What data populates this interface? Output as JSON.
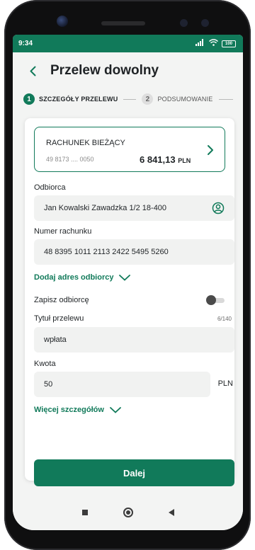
{
  "status_bar": {
    "time": "9:34",
    "signal": "5G",
    "battery": "100"
  },
  "header": {
    "title": "Przelew dowolny"
  },
  "steps": [
    {
      "number": "1",
      "label": "SZCZEGÓŁY PRZELEWU"
    },
    {
      "number": "2",
      "label": "PODSUMOWANIE"
    }
  ],
  "account": {
    "name": "RACHUNEK BIEŻĄCY",
    "number": "49 8173 .... 0050",
    "balance": "6 841,13",
    "currency": "PLN"
  },
  "form": {
    "recipient_label": "Odbiorca",
    "recipient_value": "Jan Kowalski Zawadzka 1/2 18-400",
    "account_label": "Numer rachunku",
    "account_value": "48 8395 1011 2113 2422 5495 5260",
    "add_address_link": "Dodaj adres odbiorcy",
    "save_recipient_label": "Zapisz odbiorcę",
    "save_recipient_on": false,
    "title_label": "Tytuł przelewu",
    "title_counter": "6/140",
    "title_value": "wpłata",
    "amount_label": "Kwota",
    "amount_value": "50",
    "amount_currency": "PLN",
    "more_details_link": "Więcej szczegółów"
  },
  "actions": {
    "next_label": "Dalej"
  },
  "colors": {
    "brand": "#117a5a",
    "background": "#f3f4f3",
    "field": "#f1f2f1"
  }
}
